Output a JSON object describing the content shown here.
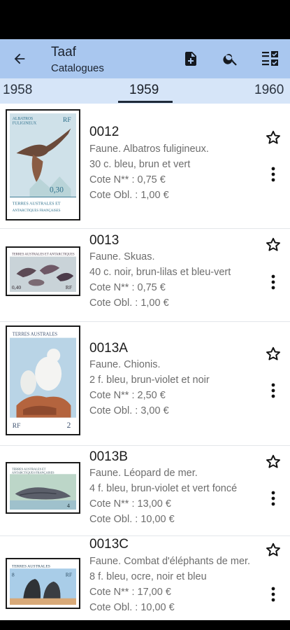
{
  "appbar": {
    "title": "Taaf",
    "subtitle": "Catalogues",
    "icons": [
      "arrow-back-icon",
      "add-document-icon",
      "search-icon",
      "checklist-icon"
    ]
  },
  "tabs": {
    "prev": "1958",
    "current": "1959",
    "next": "1960"
  },
  "items": [
    {
      "code": "0012",
      "title": "Faune. Albatros fuligineux.",
      "detail": "30 c. bleu, brun et vert",
      "cote_new": "Cote N** : 0,75 €",
      "cote_obl": "Cote Obl. : 1,00 €"
    },
    {
      "code": "0013",
      "title": "Faune. Skuas.",
      "detail": "40 c. noir, brun-lilas et bleu-vert",
      "cote_new": "Cote N** : 0,75 €",
      "cote_obl": "Cote Obl. : 1,00 €"
    },
    {
      "code": "0013A",
      "title": "Faune. Chionis.",
      "detail": "2 f. bleu, brun-violet et noir",
      "cote_new": "Cote N** : 2,50 €",
      "cote_obl": "Cote Obl. : 3,00 €"
    },
    {
      "code": "0013B",
      "title": "Faune. Léopard de mer.",
      "detail": "4 f. bleu, brun-violet et vert foncé",
      "cote_new": "Cote N** : 13,00 €",
      "cote_obl": "Cote Obl. : 10,00 €"
    },
    {
      "code": "0013C",
      "title": "Faune. Combat d'éléphants de mer.",
      "detail": "8 f. bleu, ocre, noir et bleu",
      "cote_new": "Cote N** : 17,00 €",
      "cote_obl": "Cote Obl. : 10,00 €"
    }
  ],
  "stamps": [
    {
      "top_text": "ALBATROS FULIGINEUX",
      "value": "0,30",
      "side": "RF",
      "bottom_text": "TERRES AUSTRALES ET ANTARCTIQUES FRANÇAISES"
    },
    {
      "top_text": "TERRES AUSTRALES ET ANTARCTIQUES",
      "value": "0,40",
      "side": "RF"
    },
    {
      "top_text": "TERRES AUSTRALES",
      "value": "2",
      "side": "RF"
    },
    {
      "top_text": "TERRES AUSTRALES ET ANTARCTIQUES FRANÇAISES",
      "value": "4",
      "side": "RF"
    },
    {
      "top_text": "TERRES AUSTRALES",
      "value": "8",
      "side": "RF"
    }
  ],
  "colors": {
    "appbar": "#a9c7ef",
    "tabs": "#d6e5f8",
    "indicator": "#1f2a38"
  }
}
